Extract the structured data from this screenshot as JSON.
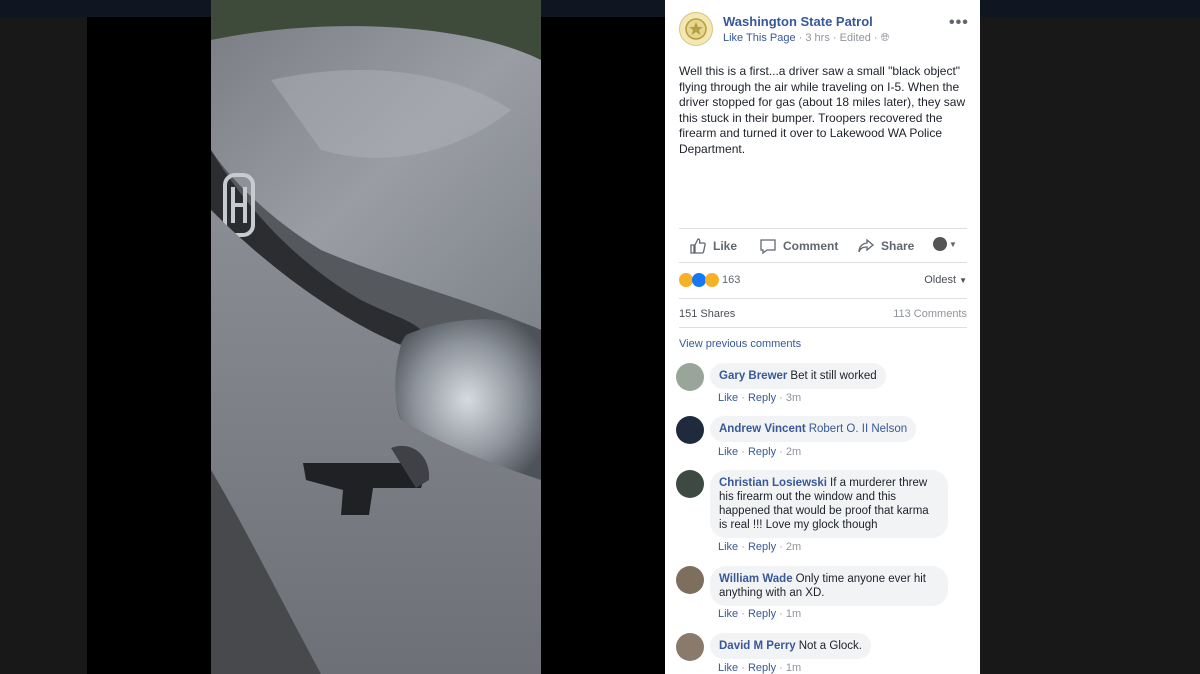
{
  "post": {
    "page_name": "Washington State Patrol",
    "like_page": "Like This Page",
    "time": "3 hrs",
    "edited": "Edited",
    "more": "•••",
    "text": "Well this is a first...a driver saw a small \"black object\" flying through the air while traveling on I-5. When the driver stopped for gas (about 18 miles later), they saw this stuck in their bumper. Troopers recovered the firearm and turned it over to Lakewood WA Police Department."
  },
  "actions": {
    "like": "Like",
    "comment": "Comment",
    "share": "Share"
  },
  "reactions": {
    "count": "163",
    "sort": "Oldest",
    "shares": "151 Shares",
    "comments": "113 Comments",
    "view_previous": "View previous comments"
  },
  "comments": [
    {
      "author": "Gary Brewer",
      "text": "Bet it still worked",
      "like": "Like",
      "reply": "Reply",
      "time": "3m"
    },
    {
      "author": "Andrew Vincent",
      "text": "Robert O. II Nelson",
      "like": "Like",
      "reply": "Reply",
      "time": "2m"
    },
    {
      "author": "Christian Losiewski",
      "text": "If a murderer threw his firearm out the window and this happened that would be proof that karma is real !!! Love my glock though",
      "like": "Like",
      "reply": "Reply",
      "time": "2m"
    },
    {
      "author": "William Wade",
      "text": "Only time anyone ever hit anything with an XD.",
      "like": "Like",
      "reply": "Reply",
      "time": "1m"
    },
    {
      "author": "David M Perry",
      "text": "Not a Glock.",
      "like": "Like",
      "reply": "Reply",
      "time": "1m"
    }
  ],
  "colors": {
    "link": "#365899",
    "comment_bg": "#f2f3f5",
    "car_gray": "#8a8d94"
  }
}
